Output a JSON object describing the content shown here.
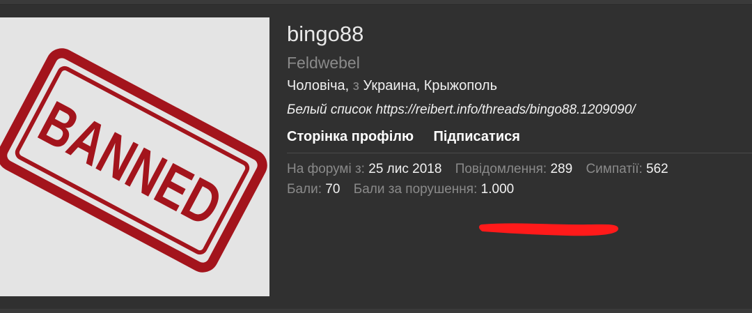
{
  "profile": {
    "username": "bingo88",
    "rank": "Feldwebel",
    "gender": "Чоловіча",
    "from_word": "з",
    "location": "Украина, Крыжополь",
    "note": "Белый список https://reibert.info/threads/bingo88.1209090/",
    "avatar_stamp_text": "BANNED"
  },
  "actions": {
    "profile_page": "Сторінка профілю",
    "follow": "Підписатися"
  },
  "stats": {
    "joined_label": "На форумі з:",
    "joined_value": "25 лис 2018",
    "messages_label": "Повідомлення:",
    "messages_value": "289",
    "likes_label": "Симпатії:",
    "likes_value": "562",
    "points_label": "Бали:",
    "points_value": "70",
    "warning_points_label": "Бали за порушення:",
    "warning_points_value": "1.000"
  },
  "colors": {
    "stamp_red": "#a3141c",
    "scribble_red": "#ff1a1a",
    "background": "#303030"
  }
}
